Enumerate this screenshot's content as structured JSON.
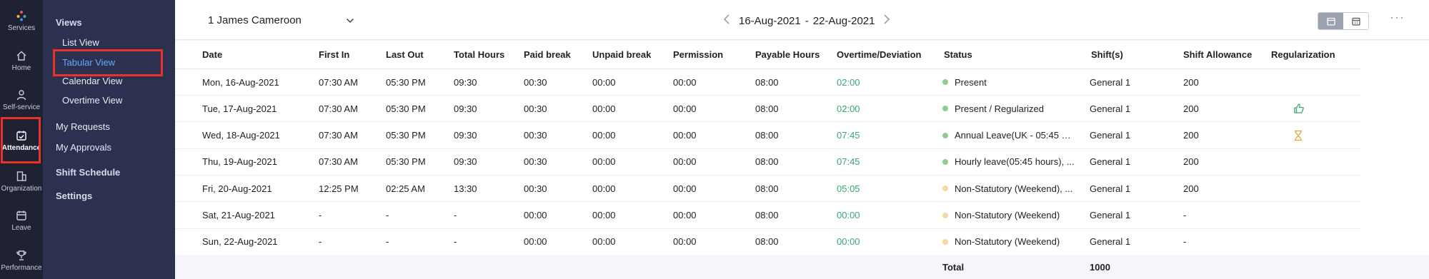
{
  "rail": {
    "items": [
      {
        "label": "Services",
        "icon": "services-icon"
      },
      {
        "label": "Home",
        "icon": "home-icon"
      },
      {
        "label": "Self-service",
        "icon": "person-icon"
      },
      {
        "label": "Attendance",
        "icon": "calendar-check-icon",
        "active": true
      },
      {
        "label": "Organization",
        "icon": "building-icon"
      },
      {
        "label": "Leave",
        "icon": "calendar-icon"
      },
      {
        "label": "Performance",
        "icon": "trophy-icon"
      }
    ]
  },
  "subnav": {
    "views_heading": "Views",
    "views": [
      "List View",
      "Tabular View",
      "Calendar View",
      "Overtime View"
    ],
    "active_view": "Tabular View",
    "main_items": [
      "My Requests",
      "My Approvals",
      "Shift Schedule",
      "Settings"
    ]
  },
  "header": {
    "employee": "1 James Cameroon",
    "range_start": "16-Aug-2021",
    "range_sep": "-",
    "range_end": "22-Aug-2021"
  },
  "table": {
    "columns": [
      "Date",
      "First In",
      "Last Out",
      "Total Hours",
      "Paid break",
      "Unpaid break",
      "Permission",
      "Payable Hours",
      "Overtime/Deviation",
      "Status",
      "Shift(s)",
      "Shift Allowance",
      "Regularization"
    ],
    "rows": [
      {
        "date": "Mon, 16-Aug-2021",
        "first_in": "07:30 AM",
        "last_out": "05:30 PM",
        "total": "09:30",
        "paid": "00:30",
        "unpaid": "00:00",
        "permission": "00:00",
        "payable": "08:00",
        "overtime": "02:00",
        "status": "Present",
        "status_color": "green",
        "shift": "General 1",
        "allowance": "200",
        "regularization": ""
      },
      {
        "date": "Tue, 17-Aug-2021",
        "first_in": "07:30 AM",
        "last_out": "05:30 PM",
        "total": "09:30",
        "paid": "00:30",
        "unpaid": "00:00",
        "permission": "00:00",
        "payable": "08:00",
        "overtime": "02:00",
        "status": "Present / Regularized",
        "status_color": "green",
        "shift": "General 1",
        "allowance": "200",
        "regularization": "thumbs-up-icon"
      },
      {
        "date": "Wed, 18-Aug-2021",
        "first_in": "07:30 AM",
        "last_out": "05:30 PM",
        "total": "09:30",
        "paid": "00:30",
        "unpaid": "00:00",
        "permission": "00:00",
        "payable": "08:00",
        "overtime": "07:45",
        "status": "Annual Leave(UK - 05:45 ho...",
        "status_color": "green",
        "shift": "General 1",
        "allowance": "200",
        "regularization": "hourglass-icon"
      },
      {
        "date": "Thu, 19-Aug-2021",
        "first_in": "07:30 AM",
        "last_out": "05:30 PM",
        "total": "09:30",
        "paid": "00:30",
        "unpaid": "00:00",
        "permission": "00:00",
        "payable": "08:00",
        "overtime": "07:45",
        "status": "Hourly leave(05:45 hours), ...",
        "status_color": "green",
        "shift": "General 1",
        "allowance": "200",
        "regularization": ""
      },
      {
        "date": "Fri, 20-Aug-2021",
        "first_in": "12:25 PM",
        "last_out": "02:25 AM",
        "total": "13:30",
        "paid": "00:30",
        "unpaid": "00:00",
        "permission": "00:00",
        "payable": "08:00",
        "overtime": "05:05",
        "status": "Non-Statutory (Weekend), ...",
        "status_color": "orange",
        "shift": "General 1",
        "allowance": "200",
        "regularization": ""
      },
      {
        "date": "Sat, 21-Aug-2021",
        "first_in": "-",
        "last_out": "-",
        "total": "-",
        "paid": "00:00",
        "unpaid": "00:00",
        "permission": "00:00",
        "payable": "08:00",
        "overtime": "00:00",
        "status": "Non-Statutory (Weekend)",
        "status_color": "orange",
        "shift": "General 1",
        "allowance": "-",
        "regularization": ""
      },
      {
        "date": "Sun, 22-Aug-2021",
        "first_in": "-",
        "last_out": "-",
        "total": "-",
        "paid": "00:00",
        "unpaid": "00:00",
        "permission": "00:00",
        "payable": "08:00",
        "overtime": "00:00",
        "status": "Non-Statutory (Weekend)",
        "status_color": "orange",
        "shift": "General 1",
        "allowance": "-",
        "regularization": ""
      }
    ],
    "total_label": "Total",
    "total_value": "1000"
  },
  "colors": {
    "overtime": "#3aa672",
    "status_green": "#8fcc8f",
    "status_orange": "#f6d8a5",
    "highlight": "#e8322a",
    "active_view": "#6aa8ff"
  }
}
